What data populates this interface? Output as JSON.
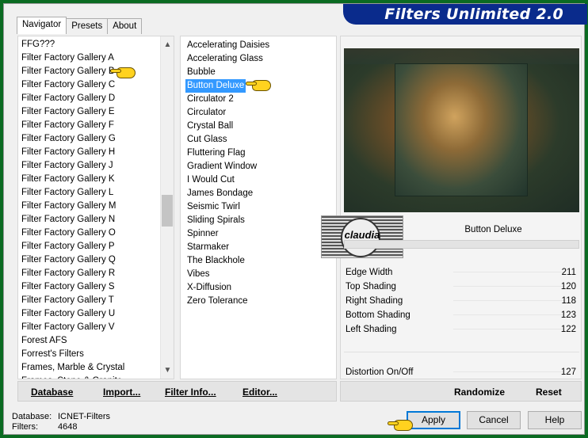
{
  "app": {
    "title": "Filters Unlimited 2.0"
  },
  "tabs": [
    {
      "label": "Navigator",
      "active": true
    },
    {
      "label": "Presets",
      "active": false
    },
    {
      "label": "About",
      "active": false
    }
  ],
  "categories": [
    "FFG???",
    "Filter Factory Gallery A",
    "Filter Factory Gallery B",
    "Filter Factory Gallery C",
    "Filter Factory Gallery D",
    "Filter Factory Gallery E",
    "Filter Factory Gallery F",
    "Filter Factory Gallery G",
    "Filter Factory Gallery H",
    "Filter Factory Gallery J",
    "Filter Factory Gallery K",
    "Filter Factory Gallery L",
    "Filter Factory Gallery M",
    "Filter Factory Gallery N",
    "Filter Factory Gallery O",
    "Filter Factory Gallery P",
    "Filter Factory Gallery Q",
    "Filter Factory Gallery R",
    "Filter Factory Gallery S",
    "Filter Factory Gallery T",
    "Filter Factory Gallery U",
    "Filter Factory Gallery V",
    "Forest AFS",
    "Forrest's Filters",
    "Frames, Marble & Crystal",
    "Frames, Stone & Granite"
  ],
  "selected_category": "Filter Factory Gallery B",
  "filters": [
    "Accelerating Daisies",
    "Accelerating Glass",
    "Bubble",
    "Button Deluxe",
    "Circulator 2",
    "Circulator",
    "Crystal Ball",
    "Cut Glass",
    "Fluttering Flag",
    "Gradient Window",
    "I Would Cut",
    "James Bondage",
    "Seismic Twirl",
    "Sliding Spirals",
    "Spinner",
    "Starmaker",
    "The Blackhole",
    "Vibes",
    "X-Diffusion",
    "Zero Tolerance"
  ],
  "selected_filter": "Button Deluxe",
  "preview": {
    "filter_name": "Button Deluxe",
    "watermark": "claudia"
  },
  "params": [
    {
      "name": "Edge Width",
      "value": "211"
    },
    {
      "name": "Top Shading",
      "value": "120"
    },
    {
      "name": "Right Shading",
      "value": "118"
    },
    {
      "name": "Bottom Shading",
      "value": "123"
    },
    {
      "name": "Left Shading",
      "value": "122"
    },
    {
      "name": "Distortion On/Off",
      "value": "127"
    }
  ],
  "left_buttons": {
    "database": "Database",
    "import": "Import...",
    "filter_info": "Filter Info...",
    "editor": "Editor..."
  },
  "right_buttons": {
    "randomize": "Randomize",
    "reset": "Reset"
  },
  "status": {
    "database_label": "Database:",
    "database_value": "ICNET-Filters",
    "filters_label": "Filters:",
    "filters_value": "4648"
  },
  "dialog_buttons": {
    "apply": "Apply",
    "cancel": "Cancel",
    "help": "Help"
  },
  "colors": {
    "banner": "#0a2b8c",
    "selection": "#3399ff",
    "frame": "#0b6b22"
  }
}
